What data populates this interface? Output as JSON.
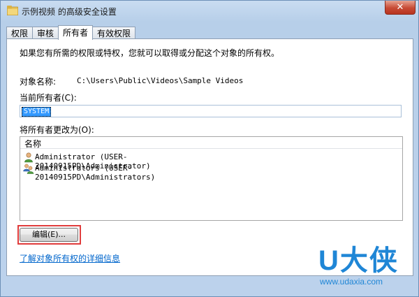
{
  "window": {
    "title": "示例视频 的高级安全设置",
    "close_label": "✕"
  },
  "tabs": [
    {
      "label": "权限"
    },
    {
      "label": "审核"
    },
    {
      "label": "所有者",
      "active": true
    },
    {
      "label": "有效权限"
    }
  ],
  "owner_tab": {
    "intro": "如果您有所需的权限或特权，您就可以取得或分配这个对象的所有权。",
    "object_name_label": "对象名称:",
    "object_name_value": "C:\\Users\\Public\\Videos\\Sample Videos",
    "current_owner_label": "当前所有者(C):",
    "current_owner_value": "SYSTEM",
    "change_owner_label": "将所有者更改为(O):",
    "list_header": "名称",
    "owners": [
      {
        "name": "Administrator (USER-20140915PD\\Administrator)",
        "icon": "user-icon"
      },
      {
        "name": "Administrators (USER-20140915PD\\Administrators)",
        "icon": "users-group-icon"
      }
    ],
    "edit_button": "编辑(E)...",
    "details_link": "了解对象所有权的详细信息"
  },
  "watermark": {
    "brand": "U大侠",
    "url": "www.udaxia.com"
  },
  "colors": {
    "highlight_box": "#e03c3c",
    "link": "#0066cc",
    "selection": "#3399ff",
    "brand": "#1f86d6"
  }
}
